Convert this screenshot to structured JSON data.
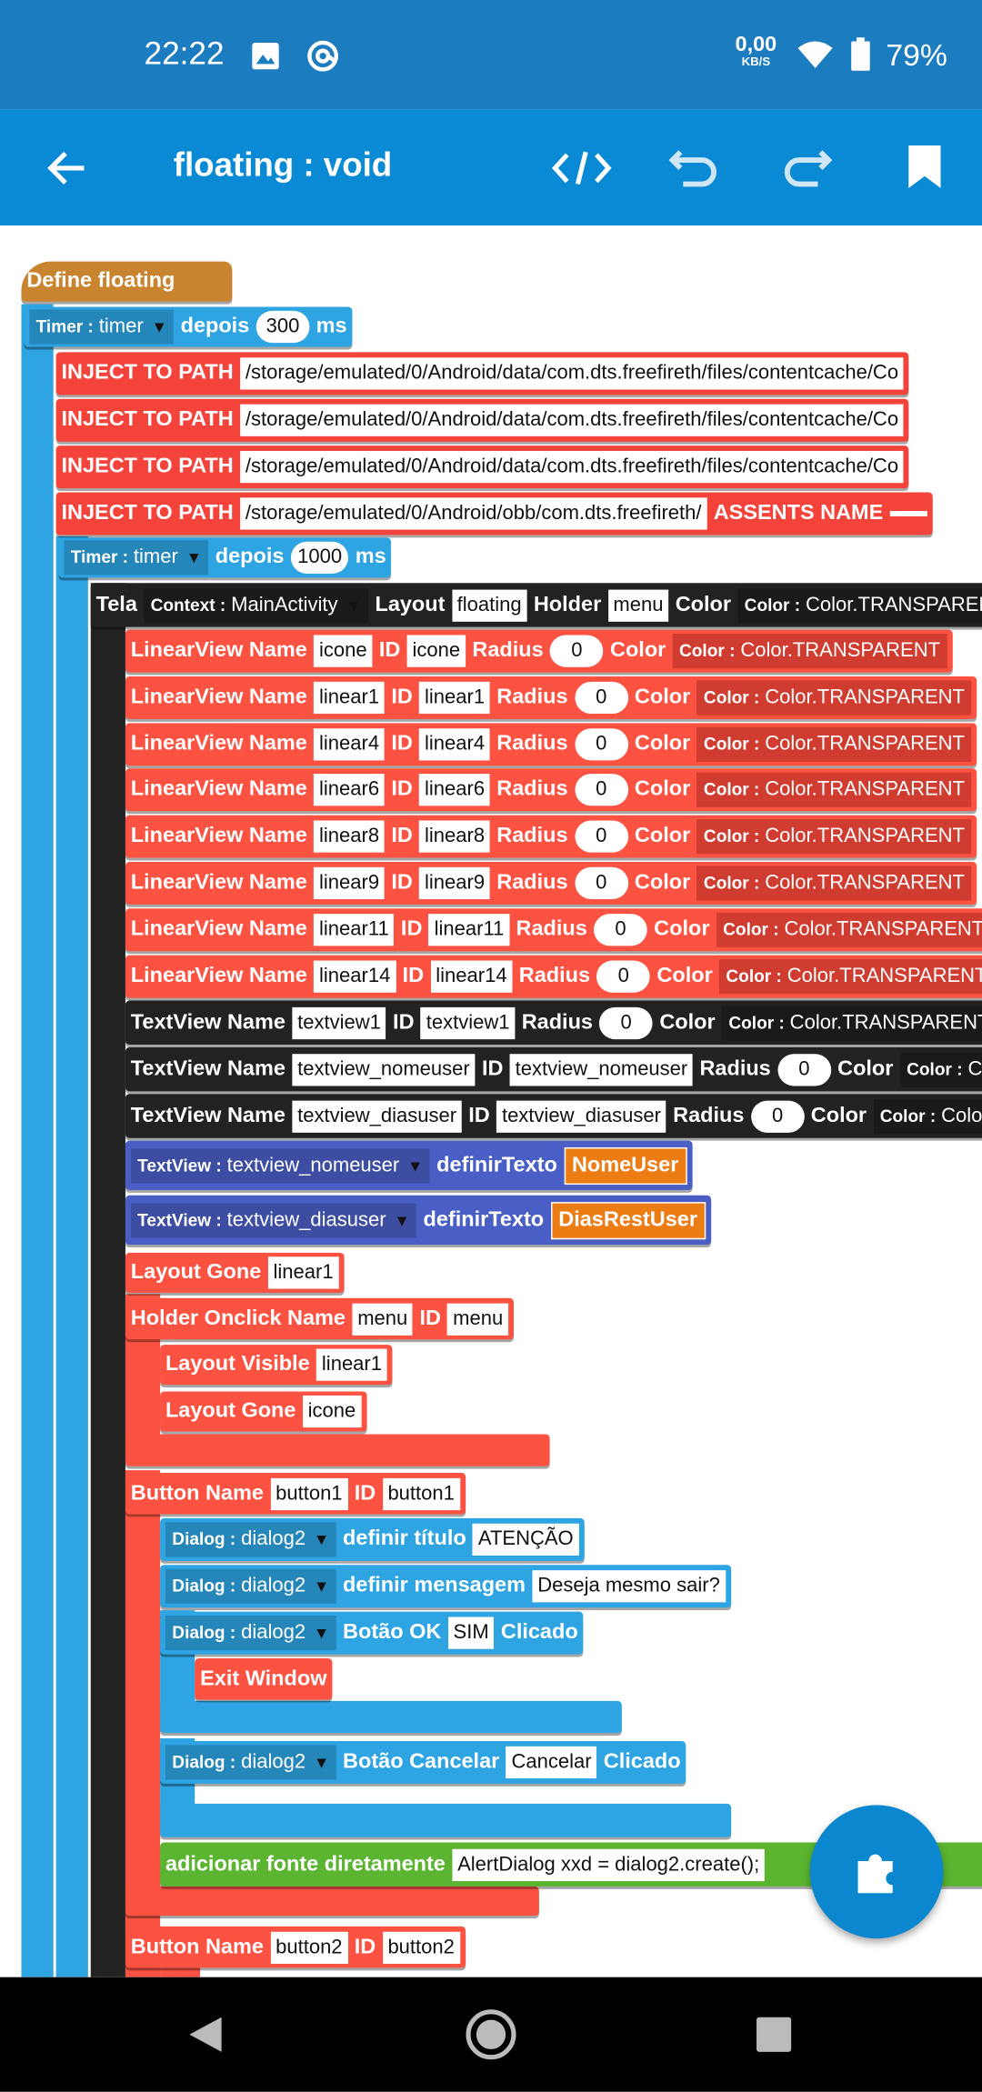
{
  "status_bar": {
    "time": "22:22",
    "net_speed": "0,00",
    "net_unit": "KB/S",
    "battery": "79%",
    "icons": [
      "image-icon",
      "at-sign-icon",
      "wifi-icon",
      "battery-icon"
    ]
  },
  "app_bar": {
    "title": "floating : void",
    "icons": [
      "back-arrow-icon",
      "code-icon",
      "undo-icon",
      "redo-icon",
      "bookmark-icon"
    ]
  },
  "colors": {
    "define": "#c8842f",
    "timer": "#2ea4e2",
    "inject": "#f4433a",
    "tela": "#222222",
    "linear": "#fc5241",
    "textview": "#222222",
    "settext": "#4a5fc6",
    "red": "#fc5241",
    "dialog": "#2ea4e2",
    "green": "#5bb531",
    "orange": "#ec7c14",
    "fab": "#0b87cf"
  },
  "blocks": [
    {
      "kind": "define",
      "tokens": [
        {
          "t": "label",
          "v": "Define floating"
        }
      ]
    },
    {
      "kind": "timer",
      "tokens": [
        {
          "t": "dd",
          "k": "Timer :",
          "v": "timer"
        },
        {
          "t": "label",
          "v": "depois"
        },
        {
          "t": "pill",
          "v": "300"
        },
        {
          "t": "label",
          "v": "ms"
        }
      ]
    },
    {
      "kind": "inject",
      "tokens": [
        {
          "t": "label",
          "v": "INJECT TO PATH"
        },
        {
          "t": "field",
          "v": "/storage/emulated/0/Android/data/com.dts.freefireth/files/contentcache/Co"
        }
      ]
    },
    {
      "kind": "inject",
      "tokens": [
        {
          "t": "label",
          "v": "INJECT TO PATH"
        },
        {
          "t": "field",
          "v": "/storage/emulated/0/Android/data/com.dts.freefireth/files/contentcache/Co"
        }
      ]
    },
    {
      "kind": "inject",
      "tokens": [
        {
          "t": "label",
          "v": "INJECT TO PATH"
        },
        {
          "t": "field",
          "v": "/storage/emulated/0/Android/data/com.dts.freefireth/files/contentcache/Co"
        }
      ]
    },
    {
      "kind": "inject",
      "tokens": [
        {
          "t": "label",
          "v": "INJECT TO PATH"
        },
        {
          "t": "field",
          "v": "/storage/emulated/0/Android/obb/com.dts.freefireth/"
        },
        {
          "t": "label",
          "v": "ASSENTS NAME"
        },
        {
          "t": "field",
          "v": ""
        }
      ]
    },
    {
      "kind": "timer",
      "tokens": [
        {
          "t": "dd",
          "k": "Timer :",
          "v": "timer"
        },
        {
          "t": "label",
          "v": "depois"
        },
        {
          "t": "pill",
          "v": "1000"
        },
        {
          "t": "label",
          "v": "ms"
        }
      ]
    },
    {
      "kind": "tela",
      "tokens": [
        {
          "t": "label",
          "v": "Tela"
        },
        {
          "t": "dd",
          "k": "Context :",
          "v": "MainActivity"
        },
        {
          "t": "label",
          "v": "Layout"
        },
        {
          "t": "field",
          "v": "floating"
        },
        {
          "t": "label",
          "v": "Holder"
        },
        {
          "t": "field",
          "v": "menu"
        },
        {
          "t": "label",
          "v": "Color"
        },
        {
          "t": "ddn",
          "k": "Color :",
          "v": "Color.TRANSPARENT"
        }
      ]
    },
    {
      "kind": "linear",
      "tokens": [
        {
          "t": "label",
          "v": "LinearView Name"
        },
        {
          "t": "field",
          "v": "icone"
        },
        {
          "t": "label",
          "v": "ID"
        },
        {
          "t": "field",
          "v": "icone"
        },
        {
          "t": "label",
          "v": "Radius"
        },
        {
          "t": "pill",
          "v": "0"
        },
        {
          "t": "label",
          "v": "Color"
        },
        {
          "t": "ddn",
          "k": "Color :",
          "v": "Color.TRANSPARENT"
        }
      ]
    },
    {
      "kind": "linear",
      "tokens": [
        {
          "t": "label",
          "v": "LinearView Name"
        },
        {
          "t": "field",
          "v": "linear1"
        },
        {
          "t": "label",
          "v": "ID"
        },
        {
          "t": "field",
          "v": "linear1"
        },
        {
          "t": "label",
          "v": "Radius"
        },
        {
          "t": "pill",
          "v": "0"
        },
        {
          "t": "label",
          "v": "Color"
        },
        {
          "t": "ddn",
          "k": "Color :",
          "v": "Color.TRANSPARENT"
        }
      ]
    },
    {
      "kind": "linear",
      "tokens": [
        {
          "t": "label",
          "v": "LinearView Name"
        },
        {
          "t": "field",
          "v": "linear4"
        },
        {
          "t": "label",
          "v": "ID"
        },
        {
          "t": "field",
          "v": "linear4"
        },
        {
          "t": "label",
          "v": "Radius"
        },
        {
          "t": "pill",
          "v": "0"
        },
        {
          "t": "label",
          "v": "Color"
        },
        {
          "t": "ddn",
          "k": "Color :",
          "v": "Color.TRANSPARENT"
        }
      ]
    },
    {
      "kind": "linear",
      "tokens": [
        {
          "t": "label",
          "v": "LinearView Name"
        },
        {
          "t": "field",
          "v": "linear6"
        },
        {
          "t": "label",
          "v": "ID"
        },
        {
          "t": "field",
          "v": "linear6"
        },
        {
          "t": "label",
          "v": "Radius"
        },
        {
          "t": "pill",
          "v": "0"
        },
        {
          "t": "label",
          "v": "Color"
        },
        {
          "t": "ddn",
          "k": "Color :",
          "v": "Color.TRANSPARENT"
        }
      ]
    },
    {
      "kind": "linear",
      "tokens": [
        {
          "t": "label",
          "v": "LinearView Name"
        },
        {
          "t": "field",
          "v": "linear8"
        },
        {
          "t": "label",
          "v": "ID"
        },
        {
          "t": "field",
          "v": "linear8"
        },
        {
          "t": "label",
          "v": "Radius"
        },
        {
          "t": "pill",
          "v": "0"
        },
        {
          "t": "label",
          "v": "Color"
        },
        {
          "t": "ddn",
          "k": "Color :",
          "v": "Color.TRANSPARENT"
        }
      ]
    },
    {
      "kind": "linear",
      "tokens": [
        {
          "t": "label",
          "v": "LinearView Name"
        },
        {
          "t": "field",
          "v": "linear9"
        },
        {
          "t": "label",
          "v": "ID"
        },
        {
          "t": "field",
          "v": "linear9"
        },
        {
          "t": "label",
          "v": "Radius"
        },
        {
          "t": "pill",
          "v": "0"
        },
        {
          "t": "label",
          "v": "Color"
        },
        {
          "t": "ddn",
          "k": "Color :",
          "v": "Color.TRANSPARENT"
        }
      ]
    },
    {
      "kind": "linear",
      "tokens": [
        {
          "t": "label",
          "v": "LinearView Name"
        },
        {
          "t": "field",
          "v": "linear11"
        },
        {
          "t": "label",
          "v": "ID"
        },
        {
          "t": "field",
          "v": "linear11"
        },
        {
          "t": "label",
          "v": "Radius"
        },
        {
          "t": "pill",
          "v": "0"
        },
        {
          "t": "label",
          "v": "Color"
        },
        {
          "t": "ddn",
          "k": "Color :",
          "v": "Color.TRANSPARENT"
        }
      ]
    },
    {
      "kind": "linear",
      "tokens": [
        {
          "t": "label",
          "v": "LinearView Name"
        },
        {
          "t": "field",
          "v": "linear14"
        },
        {
          "t": "label",
          "v": "ID"
        },
        {
          "t": "field",
          "v": "linear14"
        },
        {
          "t": "label",
          "v": "Radius"
        },
        {
          "t": "pill",
          "v": "0"
        },
        {
          "t": "label",
          "v": "Color"
        },
        {
          "t": "ddn",
          "k": "Color :",
          "v": "Color.TRANSPARENT"
        }
      ]
    },
    {
      "kind": "textview",
      "tokens": [
        {
          "t": "label",
          "v": "TextView Name"
        },
        {
          "t": "field",
          "v": "textview1"
        },
        {
          "t": "label",
          "v": "ID"
        },
        {
          "t": "field",
          "v": "textview1"
        },
        {
          "t": "label",
          "v": "Radius"
        },
        {
          "t": "pill",
          "v": "0"
        },
        {
          "t": "label",
          "v": "Color"
        },
        {
          "t": "ddn",
          "k": "Color :",
          "v": "Color.TRANSPARENT"
        }
      ]
    },
    {
      "kind": "textview",
      "tokens": [
        {
          "t": "label",
          "v": "TextView Name"
        },
        {
          "t": "field",
          "v": "textview_nomeuser"
        },
        {
          "t": "label",
          "v": "ID"
        },
        {
          "t": "field",
          "v": "textview_nomeuser"
        },
        {
          "t": "label",
          "v": "Radius"
        },
        {
          "t": "pill",
          "v": "0"
        },
        {
          "t": "label",
          "v": "Color"
        },
        {
          "t": "ddn",
          "k": "Color :",
          "v": "Color.TRANSPARENT"
        }
      ]
    },
    {
      "kind": "textview",
      "tokens": [
        {
          "t": "label",
          "v": "TextView Name"
        },
        {
          "t": "field",
          "v": "textview_diasuser"
        },
        {
          "t": "label",
          "v": "ID"
        },
        {
          "t": "field",
          "v": "textview_diasuser"
        },
        {
          "t": "label",
          "v": "Radius"
        },
        {
          "t": "pill",
          "v": "0"
        },
        {
          "t": "label",
          "v": "Color"
        },
        {
          "t": "ddn",
          "k": "Color :",
          "v": "Color.TRANSPARENT"
        }
      ]
    },
    {
      "kind": "settext",
      "tokens": [
        {
          "t": "dd",
          "k": "TextView :",
          "v": "textview_nomeuser"
        },
        {
          "t": "label",
          "v": "definirTexto"
        },
        {
          "t": "orange",
          "v": "NomeUser"
        }
      ]
    },
    {
      "kind": "settext",
      "tokens": [
        {
          "t": "dd",
          "k": "TextView :",
          "v": "textview_diasuser"
        },
        {
          "t": "label",
          "v": "definirTexto"
        },
        {
          "t": "orange",
          "v": "DiasRestUser"
        }
      ]
    },
    {
      "kind": "red",
      "tokens": [
        {
          "t": "label",
          "v": "Layout Gone"
        },
        {
          "t": "field",
          "v": "linear1"
        }
      ]
    },
    {
      "kind": "red",
      "tokens": [
        {
          "t": "label",
          "v": "Holder Onclick Name"
        },
        {
          "t": "field",
          "v": "menu"
        },
        {
          "t": "label",
          "v": "ID"
        },
        {
          "t": "field",
          "v": "menu"
        }
      ]
    },
    {
      "kind": "red",
      "tokens": [
        {
          "t": "label",
          "v": "Layout Visible"
        },
        {
          "t": "field",
          "v": "linear1"
        }
      ]
    },
    {
      "kind": "red",
      "tokens": [
        {
          "t": "label",
          "v": "Layout Gone"
        },
        {
          "t": "field",
          "v": "icone"
        }
      ]
    },
    {
      "kind": "red",
      "tokens": [
        {
          "t": "label",
          "v": "Button Name"
        },
        {
          "t": "field",
          "v": "button1"
        },
        {
          "t": "label",
          "v": "ID"
        },
        {
          "t": "field",
          "v": "button1"
        }
      ]
    },
    {
      "kind": "dialog",
      "tokens": [
        {
          "t": "dd",
          "k": "Dialog :",
          "v": "dialog2"
        },
        {
          "t": "label",
          "v": "definir título"
        },
        {
          "t": "field",
          "v": "ATENÇÃO"
        }
      ]
    },
    {
      "kind": "dialog",
      "tokens": [
        {
          "t": "dd",
          "k": "Dialog :",
          "v": "dialog2"
        },
        {
          "t": "label",
          "v": "definir mensagem"
        },
        {
          "t": "field",
          "v": "Deseja mesmo sair?"
        }
      ]
    },
    {
      "kind": "dialog",
      "tokens": [
        {
          "t": "dd",
          "k": "Dialog :",
          "v": "dialog2"
        },
        {
          "t": "label",
          "v": "Botão OK"
        },
        {
          "t": "field",
          "v": "SIM"
        },
        {
          "t": "label",
          "v": "Clicado"
        }
      ]
    },
    {
      "kind": "red",
      "tokens": [
        {
          "t": "label",
          "v": "Exit Window"
        }
      ]
    },
    {
      "kind": "dialog",
      "tokens": [
        {
          "t": "dd",
          "k": "Dialog :",
          "v": "dialog2"
        },
        {
          "t": "label",
          "v": "Botão Cancelar"
        },
        {
          "t": "field",
          "v": "Cancelar"
        },
        {
          "t": "label",
          "v": "Clicado"
        }
      ]
    },
    {
      "kind": "green",
      "tokens": [
        {
          "t": "label",
          "v": "adicionar fonte diretamente"
        },
        {
          "t": "field",
          "v": "AlertDialog xxd = dialog2.create();"
        }
      ]
    },
    {
      "kind": "red",
      "tokens": [
        {
          "t": "label",
          "v": "Button Name"
        },
        {
          "t": "field",
          "v": "button2"
        },
        {
          "t": "label",
          "v": "ID"
        },
        {
          "t": "field",
          "v": "button2"
        }
      ]
    }
  ],
  "fab": {
    "icon": "puzzle-piece-icon"
  },
  "nav_bar": {
    "icons": [
      "nav-back-icon",
      "nav-home-icon",
      "nav-recents-icon"
    ]
  }
}
